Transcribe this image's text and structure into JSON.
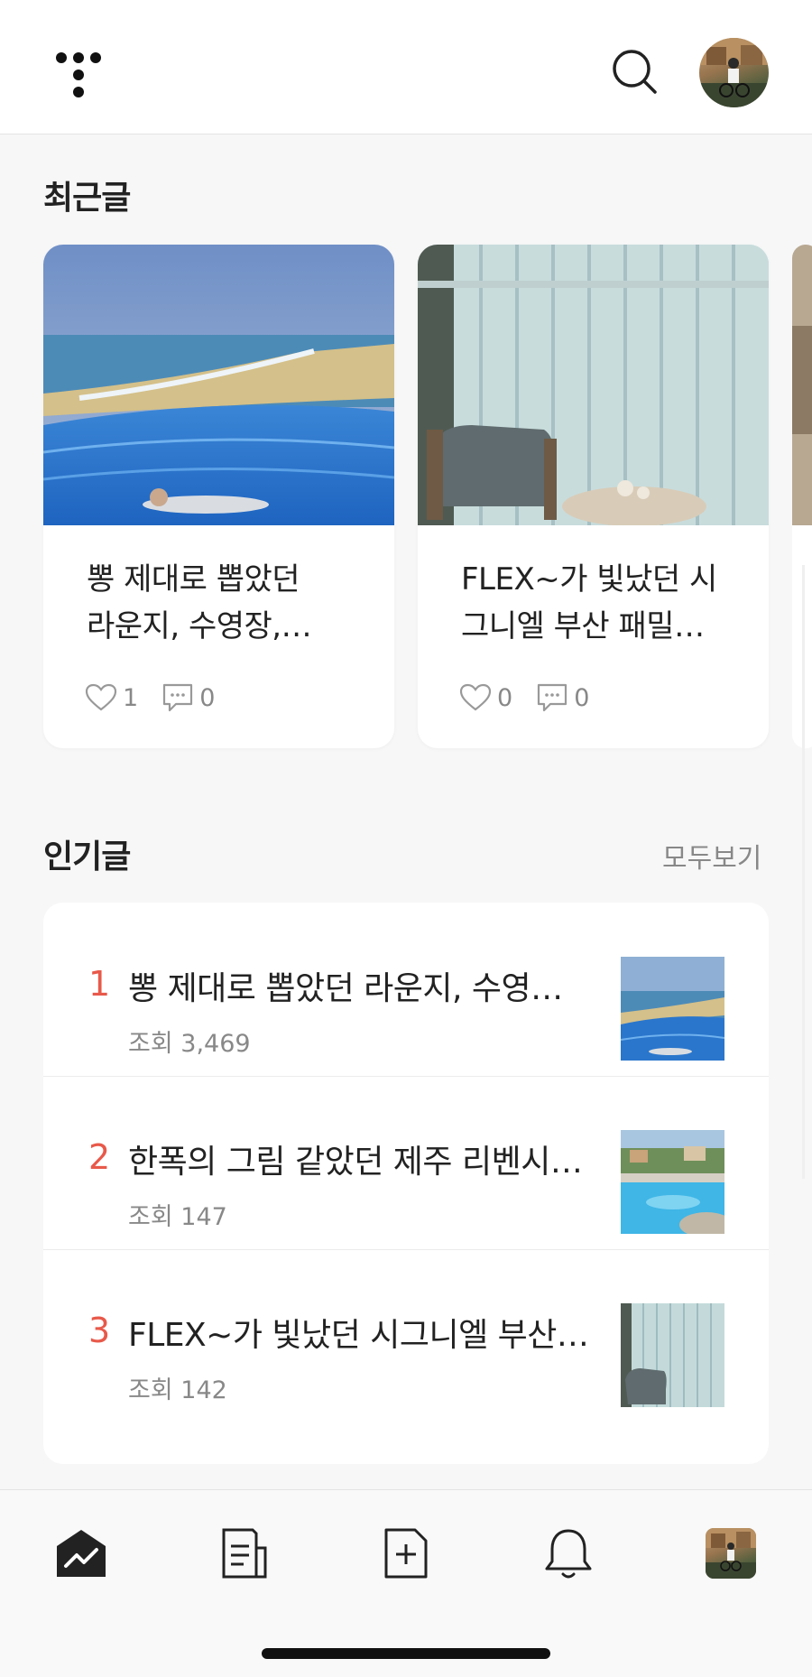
{
  "header": {
    "logo_icon": "tistory-logo-icon",
    "search_icon": "search-icon",
    "avatar_icon": "profile-avatar"
  },
  "recent": {
    "title": "최근글",
    "cards": [
      {
        "title_line1": "뽕 제대로 뽑았던",
        "title_line2": "라운지, 수영장,…",
        "likes": "1",
        "comments": "0",
        "image": "infinity-pool-ocean-photo"
      },
      {
        "title_line1": "FLEX~가 빛났던 시",
        "title_line2": "그니엘 부산 패밀…",
        "likes": "0",
        "comments": "0",
        "image": "hotel-room-curtain-chair-photo"
      }
    ]
  },
  "popular": {
    "title": "인기글",
    "see_all": "모두보기",
    "items": [
      {
        "rank": "1",
        "title": "뽕 제대로 뽑았던 라운지, 수영…",
        "views": "조회 3,469",
        "thumb": "infinity-pool-ocean-photo"
      },
      {
        "rank": "2",
        "title": "한폭의 그림 같았던 제주 리벤시…",
        "views": "조회 147",
        "thumb": "resort-pool-photo"
      },
      {
        "rank": "3",
        "title": "FLEX~가 빛났던 시그니엘 부산…",
        "views": "조회 142",
        "thumb": "hotel-room-curtain-chair-photo"
      }
    ]
  },
  "bottom_nav": {
    "items": [
      "home-chart-icon",
      "posts-icon",
      "new-post-icon",
      "notification-bell-icon",
      "profile-avatar"
    ],
    "active": "home-chart-icon"
  },
  "colors": {
    "accent_rank": "#e8594a",
    "background": "#f7f7f7",
    "card": "#ffffff",
    "muted_text": "#888888"
  }
}
